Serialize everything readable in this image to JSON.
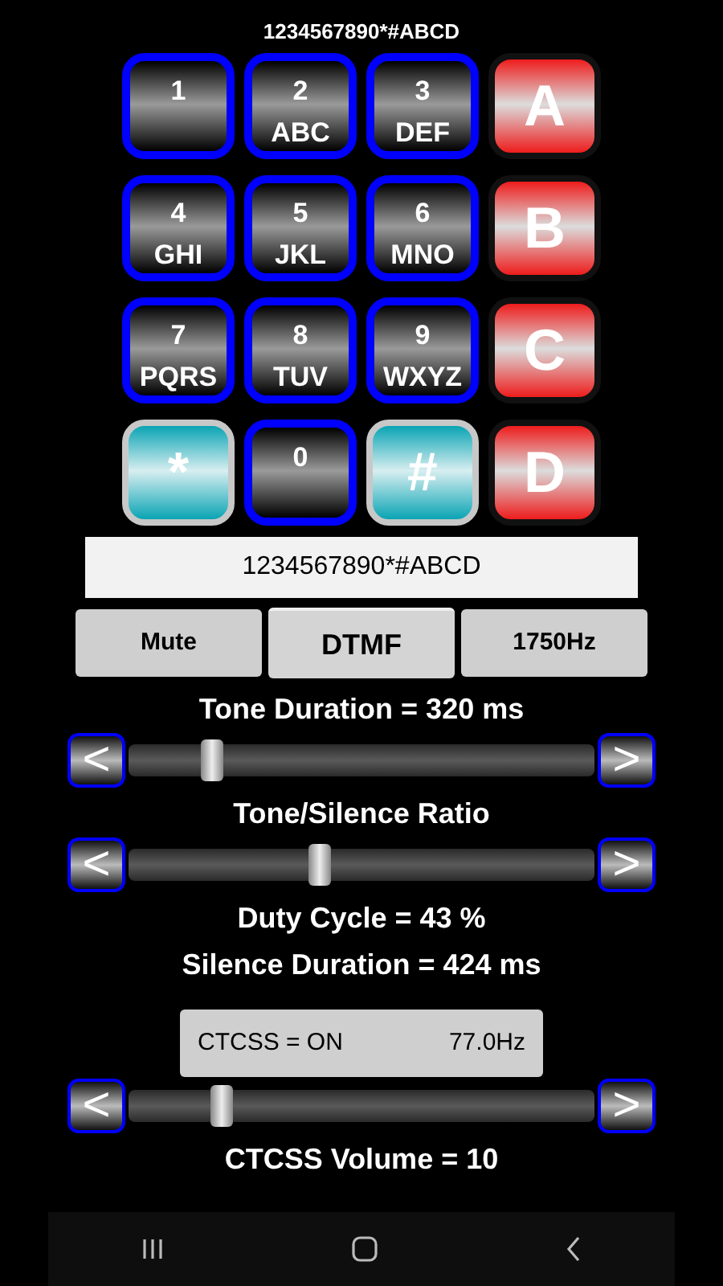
{
  "header": {
    "title": "1234567890*#ABCD"
  },
  "keypad": [
    {
      "kind": "digit",
      "main": "1"
    },
    {
      "kind": "digit",
      "main": "2",
      "sub": "ABC"
    },
    {
      "kind": "digit",
      "main": "3",
      "sub": "DEF"
    },
    {
      "kind": "letter",
      "main": "A"
    },
    {
      "kind": "digit",
      "main": "4",
      "sub": "GHI"
    },
    {
      "kind": "digit",
      "main": "5",
      "sub": "JKL"
    },
    {
      "kind": "digit",
      "main": "6",
      "sub": "MNO"
    },
    {
      "kind": "letter",
      "main": "B"
    },
    {
      "kind": "digit",
      "main": "7",
      "sub": "PQRS"
    },
    {
      "kind": "digit",
      "main": "8",
      "sub": "TUV"
    },
    {
      "kind": "digit",
      "main": "9",
      "sub": "WXYZ"
    },
    {
      "kind": "letter",
      "main": "C"
    },
    {
      "kind": "symbol",
      "main": "*"
    },
    {
      "kind": "digit",
      "main": "0"
    },
    {
      "kind": "symbol",
      "main": "#"
    },
    {
      "kind": "letter",
      "main": "D"
    }
  ],
  "display": {
    "value": "1234567890*#ABCD"
  },
  "modes": [
    {
      "label": "Mute",
      "selected": false
    },
    {
      "label": "DTMF",
      "selected": true
    },
    {
      "label": "1750Hz",
      "selected": false
    }
  ],
  "controls": [
    {
      "kind": "label",
      "text": "Tone Duration = 320 ms"
    },
    {
      "kind": "slider",
      "left": "<",
      "right": ">",
      "level": 0.18
    },
    {
      "kind": "label",
      "text": "Tone/Silence Ratio"
    },
    {
      "kind": "slider",
      "left": "<",
      "right": ">",
      "level": 0.41
    },
    {
      "kind": "label",
      "text": "Duty Cycle = 43 %"
    },
    {
      "kind": "label",
      "text": "Silence Duration = 424 ms"
    },
    {
      "kind": "ctcss",
      "status": "CTCSS = ON",
      "frequency": "77.0Hz"
    },
    {
      "kind": "slider",
      "left": "<",
      "right": ">",
      "level": 0.2
    },
    {
      "kind": "label",
      "text": "CTCSS Volume = 10"
    }
  ]
}
